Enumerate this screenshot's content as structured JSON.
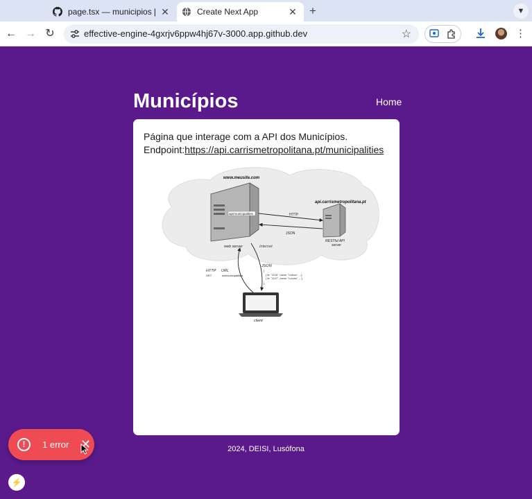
{
  "browser": {
    "tabs": [
      {
        "title": "page.tsx — municipios [Code",
        "active": false,
        "icon": "github-icon"
      },
      {
        "title": "Create Next App",
        "active": true,
        "icon": "globe-icon"
      }
    ],
    "address": "effective-engine-4gxrjv6ppw4hj67v-3000.app.github.dev"
  },
  "page": {
    "title": "Municípios",
    "nav": {
      "home": "Home"
    },
    "description": "Página que interage com a API dos Municípios.",
    "endpoint_label": "Endpoint:",
    "endpoint_url": "https://api.carrismetropolitana.pt/municipalities",
    "footer": "2024, DEISI, Lusófona"
  },
  "diagram": {
    "site": "www.meusite.com",
    "api_host": "api.carrismetropolitana.pt",
    "server_path": "api/municipalities",
    "http": "HTTP",
    "json": "JSON",
    "rest_line1": "RESTful API",
    "rest_line2": "server",
    "web_server": "web server",
    "internet": "Internet",
    "client_http": "HTTP",
    "client_url": "URL",
    "client_get": "GET",
    "client_path": "ecl/municipalities",
    "client_json": "JSON",
    "json_open": "[",
    "json_row1": "{ id: \"1106\", name: \"Lisboa\", ...},",
    "json_row2": "{ id: \"1107\", name: \"Loures\", ...},",
    "json_close": "]",
    "client": "client"
  },
  "error_overlay": {
    "label": "1 error"
  },
  "colors": {
    "page_bg": "#5a1a8c",
    "error": "#ef4b55"
  }
}
